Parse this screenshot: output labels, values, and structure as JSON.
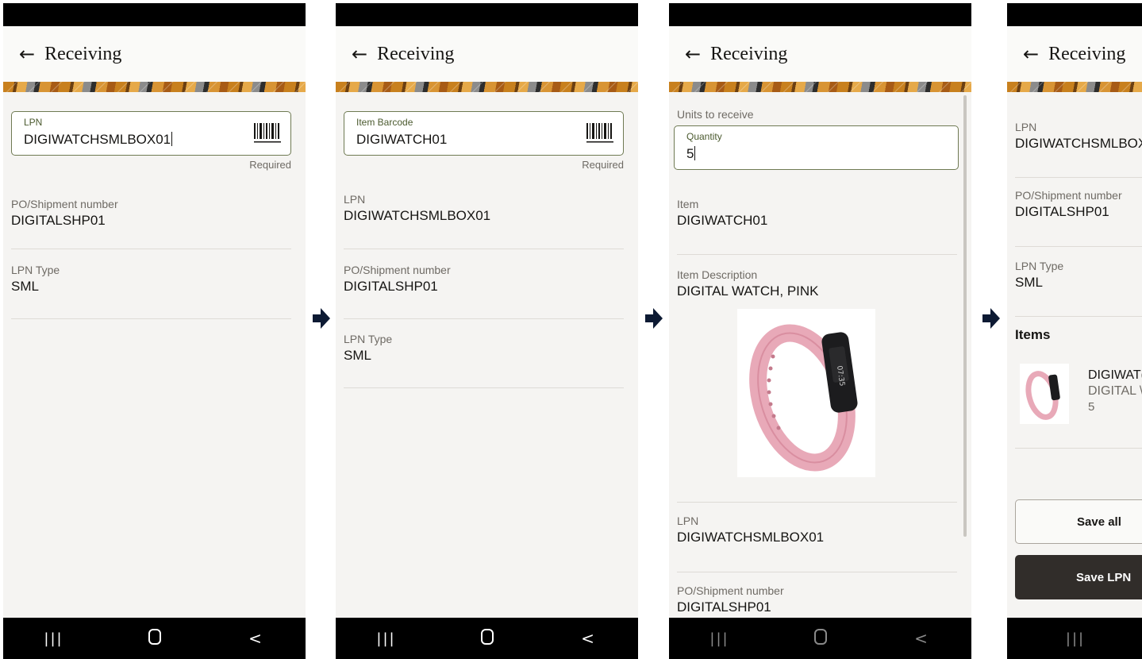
{
  "header": {
    "title": "Receiving"
  },
  "required_label": "Required",
  "screens": {
    "s1": {
      "lpn_field": {
        "label": "LPN",
        "value": "DIGIWATCHSMLBOX01"
      },
      "po": {
        "label": "PO/Shipment number",
        "value": "DIGITALSHP01"
      },
      "lpn_type": {
        "label": "LPN Type",
        "value": "SML"
      }
    },
    "s2": {
      "barcode_field": {
        "label": "Item Barcode",
        "value": "DIGIWATCH01"
      },
      "lpn": {
        "label": "LPN",
        "value": "DIGIWATCHSMLBOX01"
      },
      "po": {
        "label": "PO/Shipment number",
        "value": "DIGITALSHP01"
      },
      "lpn_type": {
        "label": "LPN Type",
        "value": "SML"
      }
    },
    "s3": {
      "units_label": "Units to receive",
      "quantity_field": {
        "label": "Quantity",
        "value": "5"
      },
      "item": {
        "label": "Item",
        "value": "DIGIWATCH01"
      },
      "item_description": {
        "label": "Item Description",
        "value": "DIGITAL WATCH, PINK"
      },
      "lpn": {
        "label": "LPN",
        "value": "DIGIWATCHSMLBOX01"
      },
      "po": {
        "label": "PO/Shipment number",
        "value": "DIGITALSHP01"
      }
    },
    "s4": {
      "lpn": {
        "label": "LPN",
        "value": "DIGIWATCHSMLBOX("
      },
      "po": {
        "label": "PO/Shipment number",
        "value": "DIGITALSHP01"
      },
      "lpn_type": {
        "label": "LPN Type",
        "value": "SML"
      },
      "items_heading": "Items",
      "item_card": {
        "line1": "DIGIWAT(",
        "line2": "DIGITAL \\",
        "line3": "5"
      },
      "save_all_button": "Save all",
      "save_lpn_button": "Save LPN"
    }
  },
  "nav": {
    "recent": "|||",
    "home": "",
    "back": "<"
  },
  "colors": {
    "field_border": "#6f7a53",
    "dark_button": "#312d2a",
    "watch_pink": "#e8a9b8"
  }
}
